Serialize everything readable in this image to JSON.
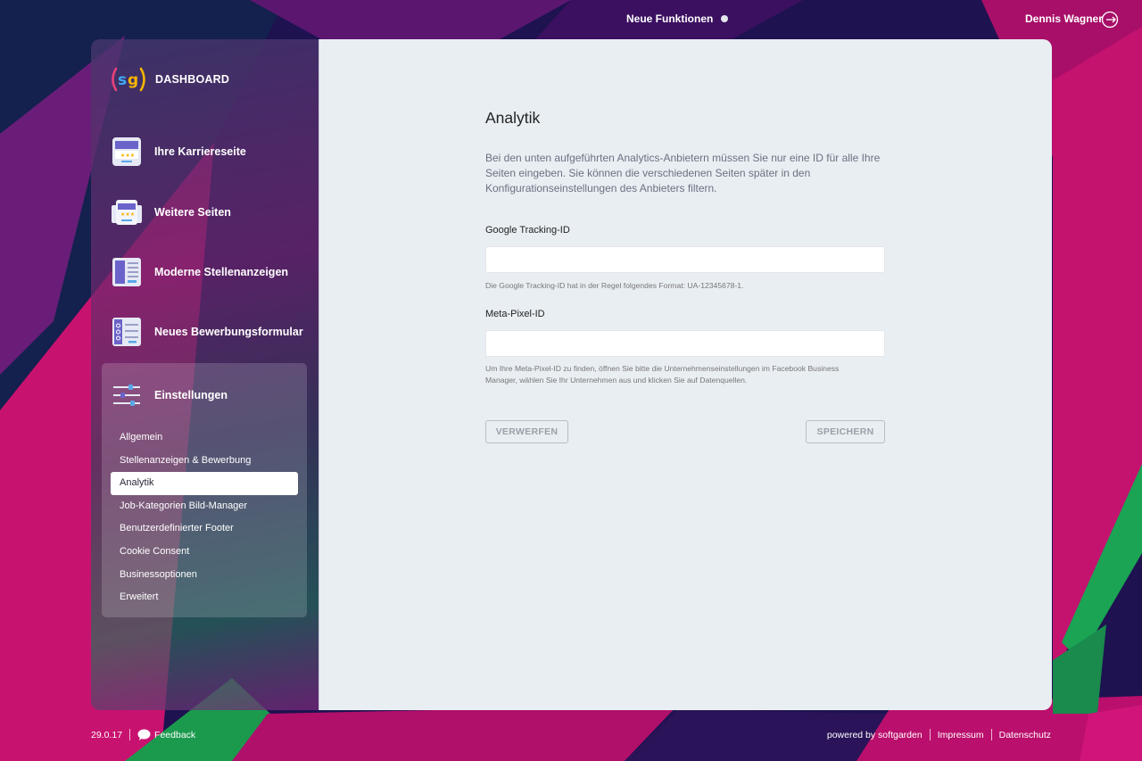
{
  "topbar": {
    "new_features_label": "Neue Funktionen",
    "user_name": "Dennis Wagner"
  },
  "sidebar": {
    "brand_label": "DASHBOARD",
    "items": [
      {
        "label": "Ihre Karriereseite",
        "icon": "career-page-icon"
      },
      {
        "label": "Weitere Seiten",
        "icon": "more-pages-icon"
      },
      {
        "label": "Moderne Stellenanzeigen",
        "icon": "job-ads-icon"
      },
      {
        "label": "Neues Bewerbungsformular",
        "icon": "application-form-icon"
      }
    ],
    "settings": {
      "label": "Einstellungen",
      "icon": "settings-sliders-icon",
      "subitems": [
        {
          "label": "Allgemein",
          "active": false
        },
        {
          "label": "Stellenanzeigen & Bewerbung",
          "active": false
        },
        {
          "label": "Analytik",
          "active": true
        },
        {
          "label": "Job-Kategorien Bild-Manager",
          "active": false
        },
        {
          "label": "Benutzerdefinierter Footer",
          "active": false
        },
        {
          "label": "Cookie Consent",
          "active": false
        },
        {
          "label": "Businessoptionen",
          "active": false
        },
        {
          "label": "Erweitert",
          "active": false
        }
      ]
    }
  },
  "main": {
    "title": "Analytik",
    "intro": "Bei den unten aufgeführten Analytics-Anbietern müssen Sie nur eine ID für alle Ihre Seiten eingeben. Sie können die verschiedenen Seiten später in den Konfigurationseinstellungen des Anbieters filtern.",
    "google": {
      "label": "Google Tracking-ID",
      "value": "",
      "placeholder": "",
      "hint": "Die Google Tracking-ID hat in der Regel folgendes Format: UA-12345678-1."
    },
    "meta": {
      "label": "Meta-Pixel-ID",
      "value": "",
      "placeholder": "",
      "hint": "Um Ihre Meta-Pixel-ID zu finden, öffnen Sie bitte die Unternehmenseinstellungen im Facebook Business Manager, wählen Sie Ihr Unternehmen aus und klicken Sie auf Datenquellen."
    },
    "discard_label": "VERWERFEN",
    "save_label": "SPEICHERN"
  },
  "footer": {
    "version": "29.0.17",
    "feedback_label": "Feedback",
    "powered_by": "powered by softgarden",
    "impressum": "Impressum",
    "datenschutz": "Datenschutz"
  },
  "colors": {
    "main_bg": "#e9eef3",
    "accent_pink": "#d0107a",
    "accent_green": "#1fa85a",
    "accent_purple": "#5a1a7a"
  }
}
